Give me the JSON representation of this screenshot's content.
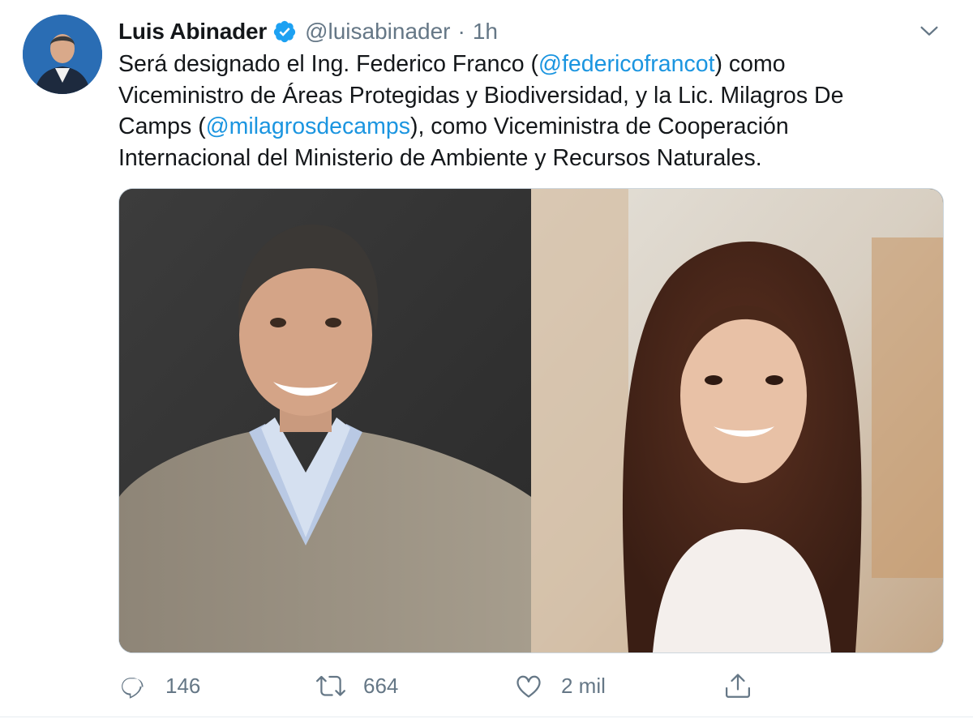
{
  "author": {
    "display_name": "Luis Abinader",
    "handle": "@luisabinader",
    "separator": "·",
    "timestamp": "1h"
  },
  "tweet": {
    "line1_pre": "Será designado el Ing. Federico Franco (",
    "mention1": "@federicofrancot",
    "line1_post": ") como",
    "line2": "Viceministro de Áreas Protegidas y Biodiversidad, y la Lic. Milagros De",
    "line3_pre": "Camps (",
    "mention2": "@milagrosdecamps",
    "line3_post": "), como Viceministra de Cooperación",
    "line4": "Internacional del Ministerio de Ambiente y Recursos Naturales."
  },
  "actions": {
    "replies": "146",
    "retweets": "664",
    "likes": "2 mil"
  },
  "icons": {
    "verified": "verified-badge-icon",
    "caret": "chevron-down-icon",
    "reply": "reply-icon",
    "retweet": "retweet-icon",
    "like": "heart-icon",
    "share": "share-icon"
  },
  "colors": {
    "link": "#1b95e0",
    "secondary_text": "#657786",
    "verified": "#1da1f2"
  }
}
